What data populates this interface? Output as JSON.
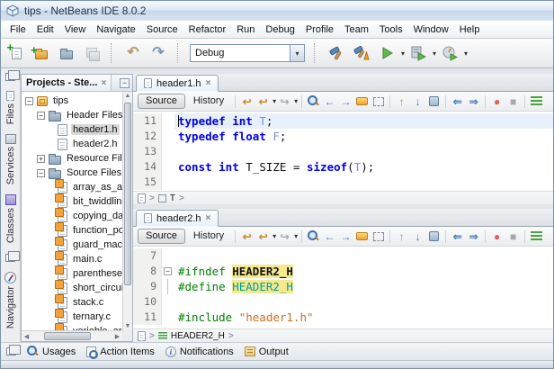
{
  "window": {
    "title": "tips - NetBeans IDE 8.0.2"
  },
  "menubar": [
    "File",
    "Edit",
    "View",
    "Navigate",
    "Source",
    "Refactor",
    "Run",
    "Debug",
    "Profile",
    "Team",
    "Tools",
    "Window",
    "Help"
  ],
  "toolbar": {
    "config": "Debug"
  },
  "sidebar": {
    "tabs": [
      "Files",
      "Services",
      "Classes",
      "Navigator"
    ]
  },
  "projects": {
    "title": "Projects - Ste...",
    "tree": [
      {
        "label": "tips"
      },
      {
        "label": "Header Files"
      },
      {
        "label": "header1.h"
      },
      {
        "label": "header2.h"
      },
      {
        "label": "Resource Files"
      },
      {
        "label": "Source Files"
      },
      {
        "label": "array_as_a"
      },
      {
        "label": "bit_twiddling"
      },
      {
        "label": "copying_da"
      },
      {
        "label": "function_po"
      },
      {
        "label": "guard_macr"
      },
      {
        "label": "main.c"
      },
      {
        "label": "parentheses"
      },
      {
        "label": "short_circui"
      },
      {
        "label": "stack.c"
      },
      {
        "label": "ternary.c"
      },
      {
        "label": "variable_arg"
      }
    ]
  },
  "editors": [
    {
      "tab": "header1.h",
      "source": "Source",
      "history": "History",
      "lines": [
        {
          "num": "11",
          "t0": "typedef int ",
          "t1": "T",
          "t2": ";"
        },
        {
          "num": "12",
          "t0": "typedef float ",
          "t1": "F",
          "t2": ";"
        },
        {
          "num": "13"
        },
        {
          "num": "14",
          "t0": "const int ",
          "t1": "T_SIZE = ",
          "t2": "sizeof",
          "t3": "(",
          "t4": "T",
          "t5": ");"
        },
        {
          "num": "15"
        }
      ],
      "breadcrumb": "T"
    },
    {
      "tab": "header2.h",
      "source": "Source",
      "history": "History",
      "lines": [
        {
          "num": "7"
        },
        {
          "num": "8",
          "t0": "#ifndef ",
          "t1": "HEADER2_H"
        },
        {
          "num": "9",
          "t0": "#define ",
          "t1": "HEADER2_H"
        },
        {
          "num": "10"
        },
        {
          "num": "11",
          "t0": "#include ",
          "t1": "\"header1.h\""
        }
      ],
      "breadcrumb": "HEADER2_H"
    }
  ],
  "statusbar": [
    "Usages",
    "Action Items",
    "Notifications",
    "Output"
  ],
  "icons": {
    "undo": "↶",
    "redo": "↷",
    "dropdown": "▾",
    "close": "×",
    "minimize": "−",
    "last_edit": "↩",
    "jump_back": "↩",
    "jump_forward": "↪",
    "find_previous": "←",
    "find_next": "→",
    "previous_bookmark": "↑",
    "next_bookmark": "↓",
    "shift_left": "⇐",
    "shift_right": "⇒",
    "record": "●",
    "stop": "■",
    "chevron": ">",
    "expand": "+",
    "collapse": "−",
    "info": "i",
    "scroll_up": "▲",
    "scroll_down": "▼",
    "scroll_left": "◀",
    "scroll_right": "▶"
  },
  "colors": {
    "keyword": "#0000e6",
    "type": "#7a8fe8",
    "preprocessor": "#008000",
    "macro": "#009b9b",
    "string": "#d2691e",
    "occurrence_highlight": "#f5e98e",
    "current_line": "#e7f0fb",
    "run_green": "#62b64e",
    "record_red": "#e06060"
  }
}
